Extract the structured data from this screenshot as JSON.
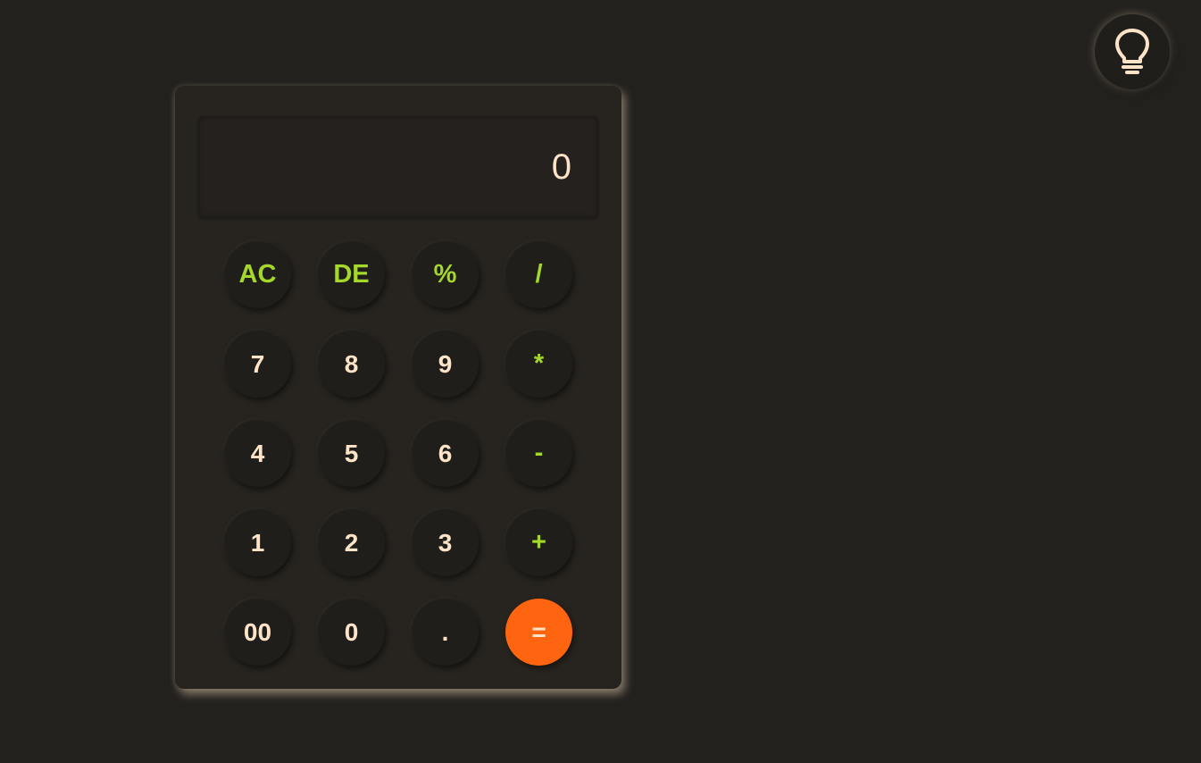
{
  "theme_toggle": {
    "icon": "lightbulb-icon"
  },
  "display": {
    "value": "0"
  },
  "colors": {
    "background": "#23211e",
    "digit_text": "#fde3c7",
    "operator_text": "#a4d82a",
    "equals_bg": "#ff6410"
  },
  "keys": {
    "ac": "AC",
    "de": "DE",
    "percent": "%",
    "divide": "/",
    "seven": "7",
    "eight": "8",
    "nine": "9",
    "multiply": "*",
    "four": "4",
    "five": "5",
    "six": "6",
    "subtract": "-",
    "one": "1",
    "two": "2",
    "three": "3",
    "add": "+",
    "double_zero": "00",
    "zero": "0",
    "decimal": ".",
    "equals": "="
  }
}
